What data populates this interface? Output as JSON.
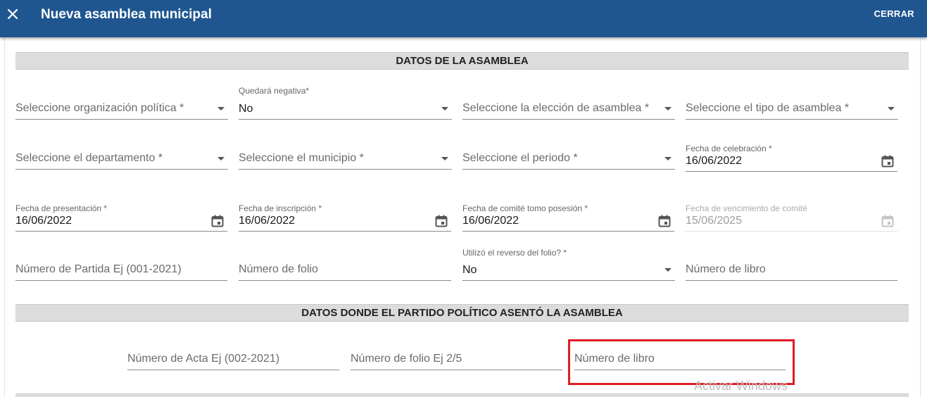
{
  "header": {
    "title": "Nueva asamblea municipal",
    "close_label": "CERRAR"
  },
  "sections": {
    "datos_asamblea": "DATOS DE LA ASAMBLEA",
    "datos_partido": "DATOS DONDE EL PARTIDO POLÍTICO ASENTÓ LA ASAMBLEA"
  },
  "form": {
    "organizacion": {
      "placeholder": "Seleccione organización política *"
    },
    "quedara": {
      "label": "Quedará negativa*",
      "value": "No"
    },
    "eleccion": {
      "placeholder": "Seleccione la elección de asamblea *"
    },
    "tipo": {
      "placeholder": "Seleccione el tipo de asamblea *"
    },
    "departamento": {
      "placeholder": "Seleccione el departamento *"
    },
    "municipio": {
      "placeholder": "Seleccione el municipio *"
    },
    "periodo": {
      "placeholder": "Seleccione el periodo *"
    },
    "fecha_celebracion": {
      "label": "Fecha de celebración *",
      "value": "16/06/2022"
    },
    "fecha_presentacion": {
      "label": "Fecha de presentación *",
      "value": "16/06/2022"
    },
    "fecha_inscripcion": {
      "label": "Fecha de inscripción *",
      "value": "16/06/2022"
    },
    "fecha_comite": {
      "label": "Fecha de comité tomo posesión *",
      "value": "16/06/2022"
    },
    "fecha_vencimiento": {
      "label": "Fecha de vencimiento de comité",
      "value": "15/06/2025"
    },
    "numero_partida": {
      "placeholder": "Número de Partida Ej (001-2021)"
    },
    "numero_folio": {
      "placeholder": "Número de folio"
    },
    "reverso_folio": {
      "label": "Utilizó el reverso del folio? *",
      "value": "No"
    },
    "numero_libro": {
      "placeholder": "Número de libro"
    },
    "numero_acta": {
      "placeholder": "Número de Acta Ej (002-2021)"
    },
    "numero_folio_partido": {
      "placeholder": "Número de folio Ej 2/5"
    },
    "numero_libro_partido": {
      "placeholder": "Número de libro"
    }
  },
  "watermark": "Activar Windows",
  "colors": {
    "toolbar": "#1f5690",
    "highlight": "#e01b24",
    "section_bg": "#dcdcdc"
  }
}
